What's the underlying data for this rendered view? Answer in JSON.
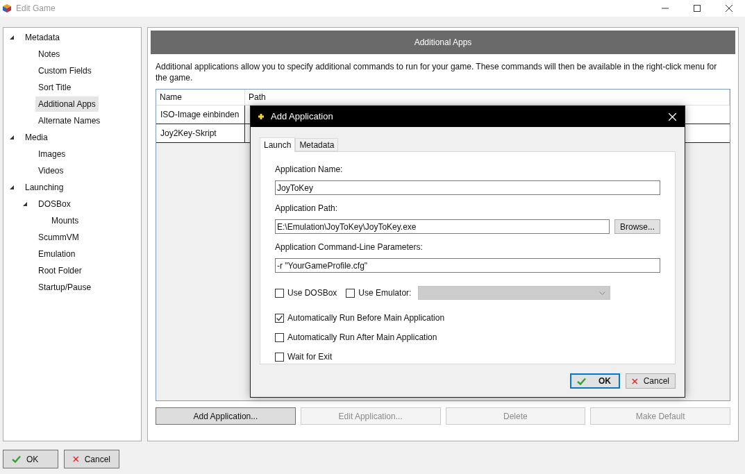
{
  "window": {
    "title": "Edit Game"
  },
  "sidebar": {
    "items": [
      {
        "label": "Metadata",
        "expanded": true,
        "selected": false,
        "children": [
          {
            "label": "Notes",
            "selected": false
          },
          {
            "label": "Custom Fields",
            "selected": false
          },
          {
            "label": "Sort Title",
            "selected": false
          },
          {
            "label": "Additional Apps",
            "selected": true
          },
          {
            "label": "Alternate Names",
            "selected": false
          }
        ]
      },
      {
        "label": "Media",
        "expanded": true,
        "selected": false,
        "children": [
          {
            "label": "Images",
            "selected": false
          },
          {
            "label": "Videos",
            "selected": false
          }
        ]
      },
      {
        "label": "Launching",
        "expanded": true,
        "selected": false,
        "children": [
          {
            "label": "DOSBox",
            "expanded": true,
            "selected": false,
            "children": [
              {
                "label": "Mounts",
                "selected": false
              }
            ]
          },
          {
            "label": "ScummVM",
            "selected": false
          },
          {
            "label": "Emulation",
            "selected": false
          },
          {
            "label": "Root Folder",
            "selected": false
          },
          {
            "label": "Startup/Pause",
            "selected": false
          }
        ]
      }
    ]
  },
  "panel": {
    "title": "Additional Apps",
    "description": "Additional applications allow you to specify additional commands to run for your game.  These commands will then be available in the right-click menu for the game.",
    "table": {
      "columns": [
        "Name",
        "Path"
      ],
      "rows": [
        [
          "ISO-Image einbinden"
        ],
        [
          "Joy2Key-Skript"
        ]
      ]
    },
    "buttons": [
      {
        "label": "Add Application...",
        "disabled": false
      },
      {
        "label": "Edit Application...",
        "disabled": true
      },
      {
        "label": "Delete",
        "disabled": true
      },
      {
        "label": "Make Default",
        "disabled": true
      }
    ]
  },
  "footer_buttons": [
    {
      "label": "OK",
      "kind": "ok"
    },
    {
      "label": "Cancel",
      "kind": "cancel"
    }
  ],
  "dialog": {
    "title": "Add Application",
    "tabs": [
      {
        "label": "Launch",
        "selected": true
      },
      {
        "label": "Metadata",
        "selected": false
      }
    ],
    "fields": [
      {
        "label": "Application Name:",
        "value": "JoyToKey"
      },
      {
        "label": "Application Path:",
        "value": "E:\\Emulation\\JoyToKey\\JoyToKey.exe",
        "button": "Browse..."
      },
      {
        "label": "Application Command-Line Parameters:",
        "value": "-r \"YourGameProfile.cfg\""
      }
    ],
    "use_dosbox": {
      "label": "Use DOSBox",
      "checked": false
    },
    "use_emulator": {
      "label": "Use Emulator:",
      "checked": false
    },
    "checkboxes": [
      {
        "label": "Automatically Run Before Main Application",
        "checked": true
      },
      {
        "label": "Automatically Run After Main Application",
        "checked": false
      },
      {
        "label": "Wait for Exit",
        "checked": false
      }
    ],
    "buttons": [
      {
        "label": "OK",
        "kind": "ok"
      },
      {
        "label": "Cancel",
        "kind": "cancel"
      }
    ]
  }
}
